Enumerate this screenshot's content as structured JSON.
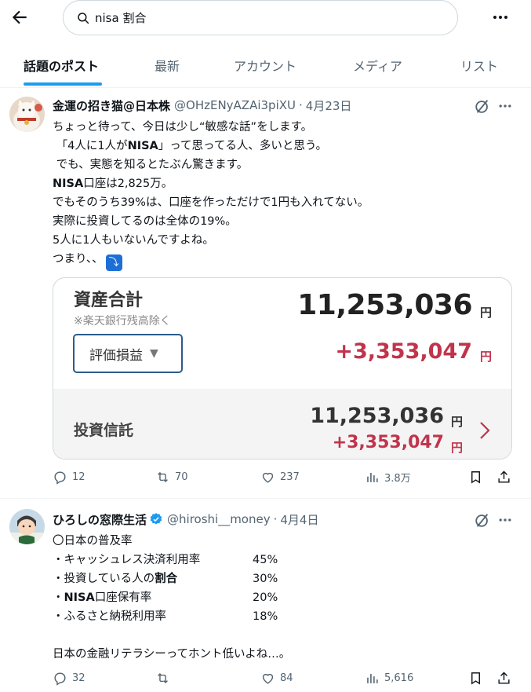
{
  "search": {
    "query": "nisa 割合"
  },
  "tabs": [
    {
      "label": "話題のポスト",
      "active": true
    },
    {
      "label": "最新"
    },
    {
      "label": "アカウント"
    },
    {
      "label": "メディア"
    },
    {
      "label": "リスト"
    }
  ],
  "posts": [
    {
      "name": "金運の招き猫@日本株",
      "handle": "@OHzENyAZAi3piXU",
      "date": "4月23日",
      "lines": [
        "ちょっと待って、今日は少し“敏感な話”をします。",
        "「4人に1人が",
        "NISA",
        "」って思ってる人、多いと思う。",
        "でも、実態を知るとたぶん驚きます。",
        "NISA",
        "口座は2,825万。",
        "でもそのうち39%は、口座を作っただけで1円も入れてない。",
        "実際に投資してるのは全体の19%。",
        "5人に1人もいないんですよね。",
        "つまり、、"
      ],
      "arrow_emoji": "⤵",
      "card": {
        "title": "資産合計",
        "note": "※楽天銀行残高除く",
        "total": "11,253,036",
        "yen": "円",
        "button": "評価損益",
        "button_icon": "▼",
        "gain": "+3,353,047",
        "sub_title": "投資信託",
        "sub_total": "11,253,036",
        "sub_gain": "+3,353,047"
      },
      "stats": {
        "replies": "12",
        "reposts": "70",
        "likes": "237",
        "views": "3.8万"
      }
    },
    {
      "name": "ひろしの窓際生活",
      "handle": "@hiroshi__money",
      "date": "4月4日",
      "lines": [
        "〇日本の普及率",
        "・キャッシュレス決済利用率",
        "・投資している人の",
        "割合",
        "・",
        "NISA",
        "口座保有率",
        "・ふるさと納税利用率",
        "日本の金融リテラシーってホント低いよね…。"
      ],
      "rates": [
        "45%",
        "30%",
        "20%",
        "18%"
      ],
      "stats": {
        "replies": "32",
        "reposts": "",
        "likes": "84",
        "views": "5,616"
      }
    }
  ],
  "colors": {
    "accent": "#1d9bf0",
    "gain": "#c0344c",
    "verified": "#1d9bf0"
  }
}
